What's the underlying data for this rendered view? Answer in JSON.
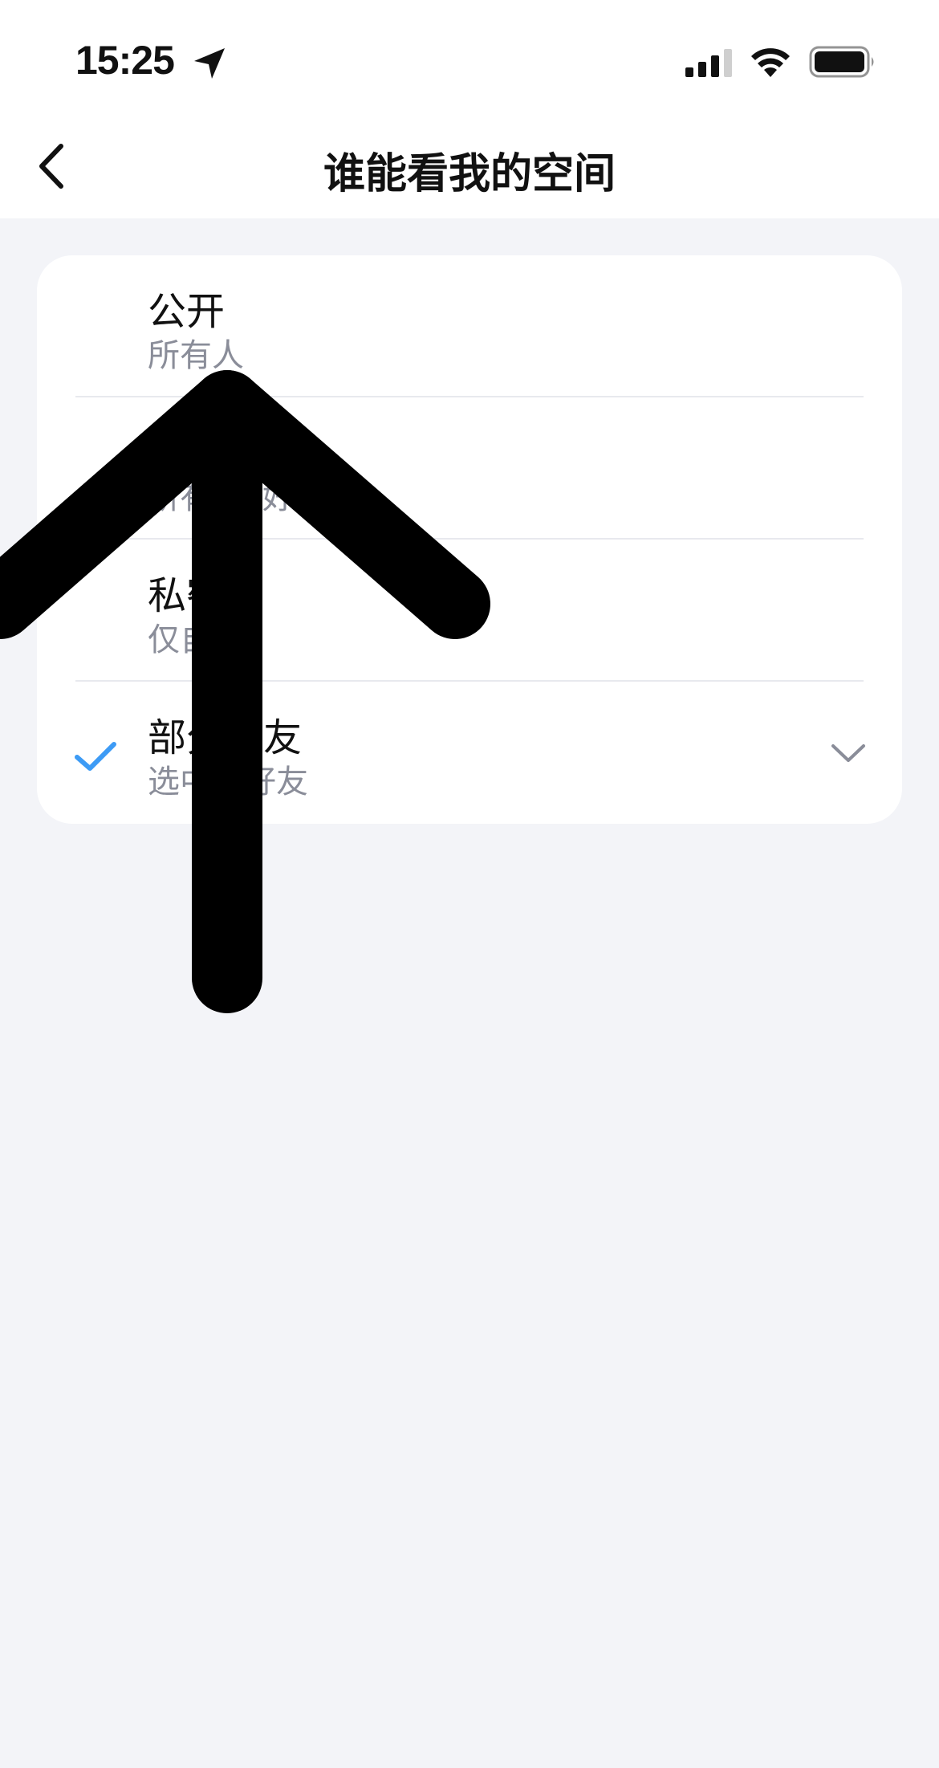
{
  "status_bar": {
    "time": "15:25",
    "icons": [
      "location-arrow-icon",
      "cellular-signal-icon",
      "wifi-icon",
      "battery-icon"
    ]
  },
  "nav": {
    "title": "谁能看我的空间",
    "back_icon": "chevron-left-icon"
  },
  "options": [
    {
      "title": "公开",
      "subtitle": "所有人",
      "selected": false
    },
    {
      "title": "",
      "subtitle": "所有QQ好友",
      "selected": false
    },
    {
      "title": "私密",
      "subtitle": "仅自己",
      "selected": false
    },
    {
      "title": "部分好友",
      "subtitle": "选中的好友",
      "selected": true,
      "expandable": true
    }
  ],
  "colors": {
    "accent": "#3d9bf5",
    "background": "#f3f4f8",
    "text_primary": "#111111",
    "text_secondary": "#8a8d99",
    "overlay_arrow": "#000000"
  },
  "overlay": {
    "type": "up-arrow-annotation"
  }
}
